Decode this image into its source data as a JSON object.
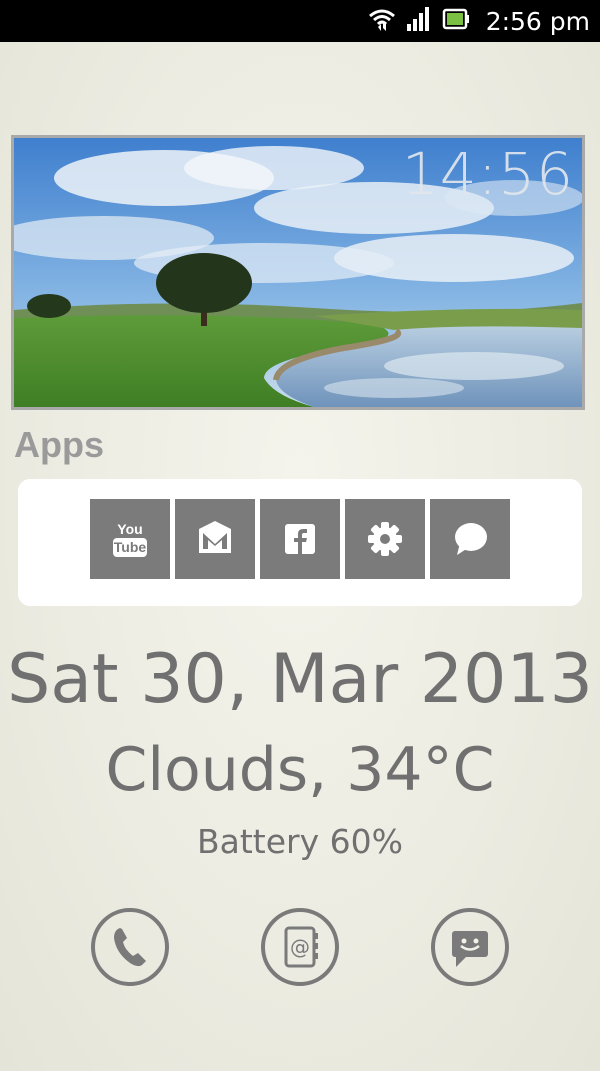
{
  "status_bar": {
    "time": "2:56 pm",
    "icons": [
      "wifi-icon",
      "signal-icon",
      "battery-icon"
    ]
  },
  "header_widget": {
    "clock": "14:56",
    "image": "golf-course-landscape-photo"
  },
  "apps": {
    "title": "Apps",
    "items": [
      {
        "name": "YouTube",
        "icon": "youtube-icon"
      },
      {
        "name": "Gmail",
        "icon": "gmail-icon"
      },
      {
        "name": "Facebook",
        "icon": "facebook-icon"
      },
      {
        "name": "Settings",
        "icon": "settings-icon"
      },
      {
        "name": "Messaging",
        "icon": "chat-bubble-icon"
      }
    ]
  },
  "info": {
    "date": "Sat 30, Mar 2013",
    "weather": "Clouds, 34°C",
    "battery": "Battery 60%"
  },
  "dock": {
    "items": [
      "phone-icon",
      "contacts-icon",
      "sms-icon"
    ]
  },
  "colors": {
    "tile": "#7b7b7b",
    "text": "#707070",
    "background": "#ececE2"
  }
}
